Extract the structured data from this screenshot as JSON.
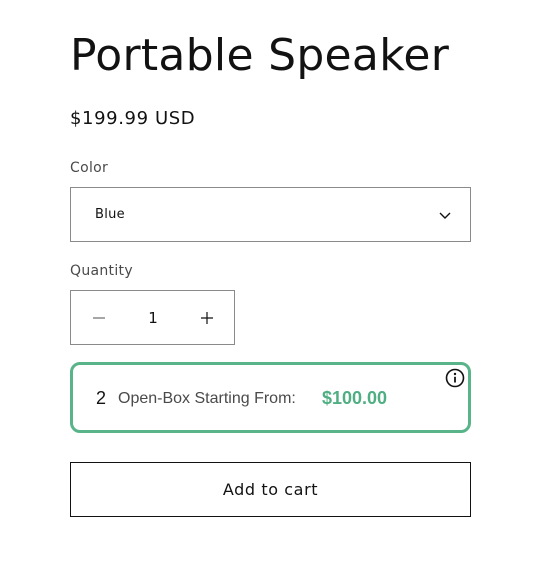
{
  "product": {
    "title": "Portable Speaker",
    "price": "$199.99 USD"
  },
  "color": {
    "label": "Color",
    "selected": "Blue",
    "icon": "chevron-down-icon"
  },
  "quantity": {
    "label": "Quantity",
    "value": "1",
    "minus_icon": "minus-icon",
    "plus_icon": "plus-icon"
  },
  "open_box": {
    "count": "2",
    "text": "Open-Box Starting From:",
    "price": "$100.00",
    "accent_color": "#5ab48a",
    "info_icon": "info-icon"
  },
  "actions": {
    "add_to_cart": "Add to cart"
  }
}
